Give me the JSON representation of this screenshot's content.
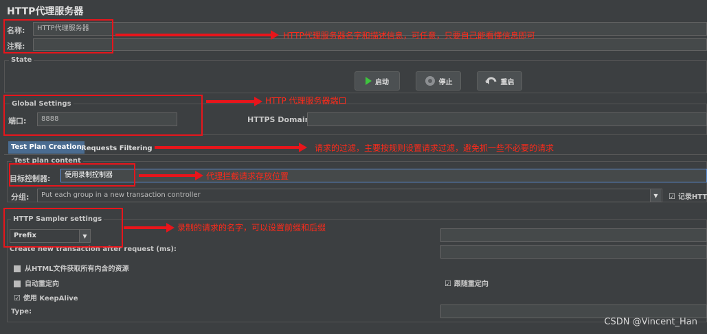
{
  "window": {
    "title": "HTTP代理服务器"
  },
  "fields": {
    "name_label": "名称:",
    "name_value": "HTTP代理服务器",
    "comment_label": "注释:"
  },
  "state": {
    "legend": "State",
    "start_label": "启动",
    "stop_label": "停止",
    "restart_label": "重启"
  },
  "global": {
    "legend": "Global Settings",
    "port_label": "端口:",
    "port_value": "8888",
    "https_label": "HTTPS Domains:"
  },
  "tabs": [
    {
      "label": "Test Plan Creation",
      "active": true
    },
    {
      "label": "Requests Filtering",
      "active": false
    }
  ],
  "test_plan": {
    "legend": "Test plan content",
    "target_label": "目标控制器:",
    "target_value": "使用录制控制器",
    "group_label": "分组:",
    "group_value": "Put each group in a new transaction controller",
    "record_label": "记录HTT"
  },
  "sampler": {
    "legend": "HTTP Sampler settings",
    "prefix_value": "Prefix",
    "create_txn_label": "Create new transaction after request (ms):",
    "retrieve_label": "从HTML文件获取所有内含的资源",
    "redirect_label": "自动重定向",
    "follow_redirect_label": "跟随重定向",
    "keepalive_label": "使用 KeepAlive",
    "type_label": "Type:"
  },
  "annotations": {
    "name_note": "HTTP代理服务器名字和描述信息，可任意，只要自己能看懂信息即可",
    "port_note": "HTTP 代理服务器端口",
    "filter_note": "请求的过滤，主要按规则设置请求过滤，避免抓一些不必要的请求",
    "target_note": "代理拦截请求存放位置",
    "sampler_note": "录制的请求的名字，可以设置前缀和后缀"
  },
  "watermark": "CSDN @Vincent_Han",
  "colors": {
    "annotation": "#e8151b",
    "background": "#3c3f41",
    "active_tab": "#4a6c91",
    "focus_border": "#5c8fd6"
  },
  "icons": {
    "start": "play-icon",
    "stop": "stop-icon",
    "restart": "restart-icon",
    "dropdown": "chevron-down-icon"
  }
}
